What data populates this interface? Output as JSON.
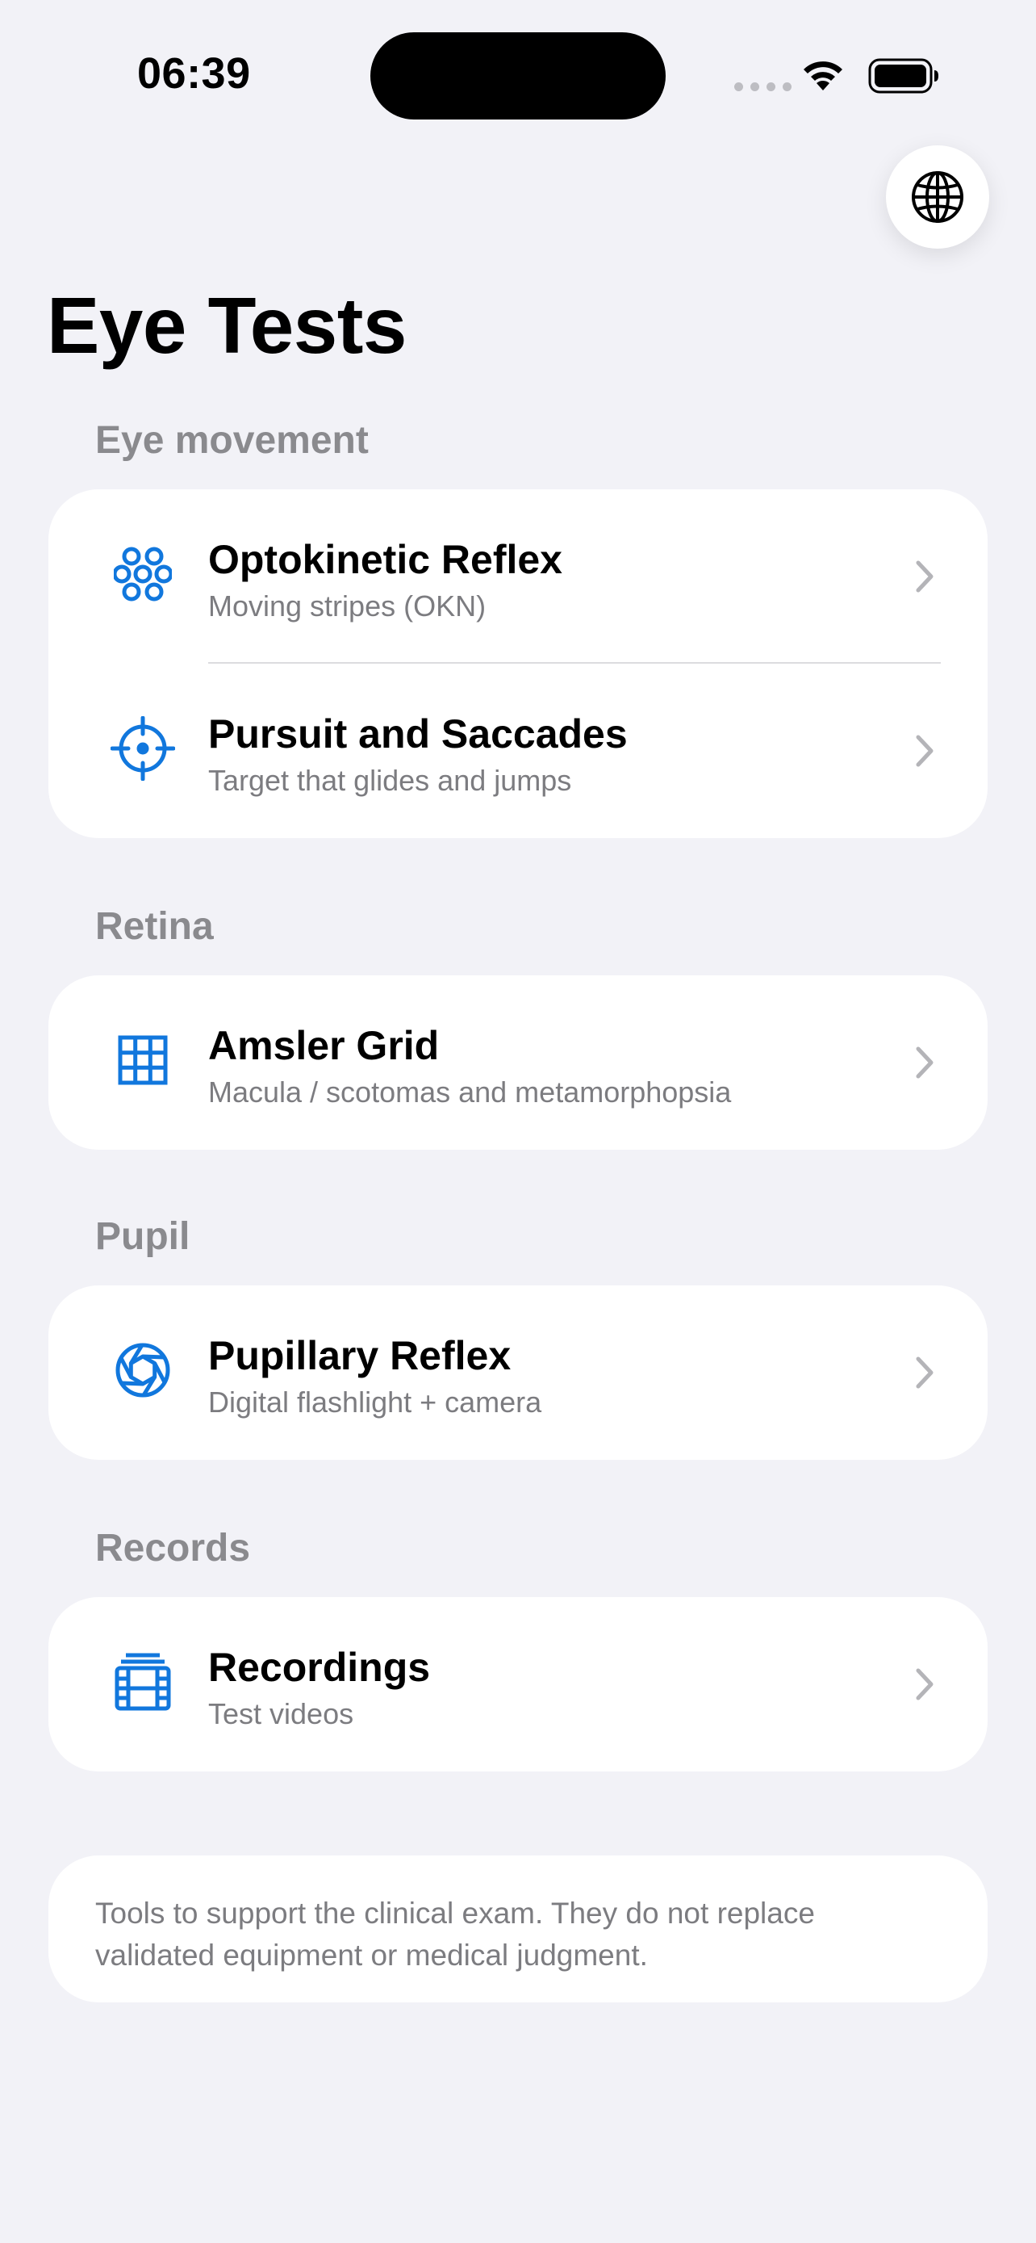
{
  "status_bar": {
    "time": "06:39"
  },
  "header": {
    "title": "Eye Tests",
    "language_icon": "globe-icon"
  },
  "colors": {
    "accent": "#1177DD",
    "background": "#F2F2F7",
    "secondary_text": "#7C7C80",
    "section_header": "#8A8A8E"
  },
  "sections": {
    "eye_movement": {
      "header": "Eye movement",
      "items": [
        {
          "title": "Optokinetic Reflex",
          "subtitle": "Moving stripes (OKN)",
          "icon": "circles-grid-icon"
        },
        {
          "title": "Pursuit and Saccades",
          "subtitle": "Target that glides and jumps",
          "icon": "crosshair-icon"
        }
      ]
    },
    "retina": {
      "header": "Retina",
      "items": [
        {
          "title": "Amsler Grid",
          "subtitle": "Macula / scotomas and metamorphopsia",
          "icon": "grid-icon"
        }
      ]
    },
    "pupil": {
      "header": "Pupil",
      "items": [
        {
          "title": "Pupillary Reflex",
          "subtitle": "Digital flashlight + camera",
          "icon": "aperture-icon"
        }
      ]
    },
    "records": {
      "header": "Records",
      "items": [
        {
          "title": "Recordings",
          "subtitle": "Test videos",
          "icon": "film-stack-icon"
        }
      ]
    }
  },
  "disclaimer": "Tools to support the clinical exam. They do not replace validated equipment or medical judgment."
}
